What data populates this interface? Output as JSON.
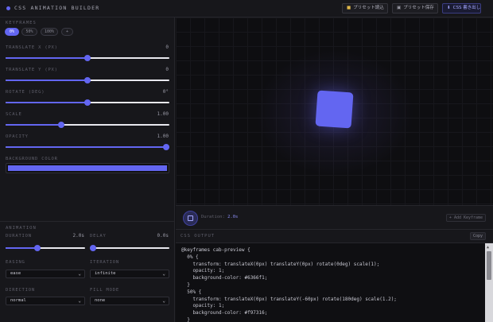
{
  "header": {
    "title": "CSS ANIMATION BUILDER",
    "load_preset": "プリセット読込",
    "save_preset": "プリセット保存",
    "export_css": "CSS 書き出し"
  },
  "keyframes": {
    "section_label": "KEYFRAMES",
    "tabs": [
      "0%",
      "50%",
      "100%",
      "+"
    ],
    "active_index": 0
  },
  "controls": [
    {
      "label": "TRANSLATE X (PX)",
      "value": "0",
      "percent": 50
    },
    {
      "label": "TRANSLATE Y (PX)",
      "value": "0",
      "percent": 50
    },
    {
      "label": "ROTATE (DEG)",
      "value": "0°",
      "percent": 50
    },
    {
      "label": "SCALE",
      "value": "1.00",
      "percent": 34
    },
    {
      "label": "OPACITY",
      "value": "1.00",
      "percent": 100
    }
  ],
  "background": {
    "label": "BACKGROUND COLOR",
    "color": "#6366f1"
  },
  "animation": {
    "section_label": "ANIMATION",
    "duration_label": "DURATION",
    "duration_value": "2.0s",
    "duration_percent": 40,
    "delay_label": "DELAY",
    "delay_value": "0.0s",
    "delay_percent": 0,
    "easing_label": "EASING",
    "easing_value": "ease",
    "iteration_label": "ITERATION",
    "iteration_value": "infinite",
    "direction_label": "DIRECTION",
    "direction_value": "normal",
    "fillmode_label": "FILL MODE",
    "fillmode_value": "none"
  },
  "timeline": {
    "duration_label": "Duration:",
    "duration_value": "2.0s",
    "add_keyframe": "+ Add Keyframe"
  },
  "code": {
    "title": "CSS OUTPUT",
    "copy": "Copy",
    "lines": [
      "@keyframes cab-preview {",
      "  0% {",
      "    transform: translateX(0px) translateY(0px) rotate(0deg) scale(1);",
      "    opacity: 1;",
      "    background-color: #6366f1;",
      "  }",
      "  50% {",
      "    transform: translateX(0px) translateY(-60px) rotate(180deg) scale(1.2);",
      "    opacity: 1;",
      "    background-color: #f97316;",
      "  }"
    ]
  },
  "icons": {
    "logo": "dot-icon",
    "load": "folder-icon",
    "save": "save-icon",
    "export": "download-icon",
    "play": "stop-icon"
  },
  "colors": {
    "accent": "#6366f1",
    "orange": "#f97316"
  }
}
